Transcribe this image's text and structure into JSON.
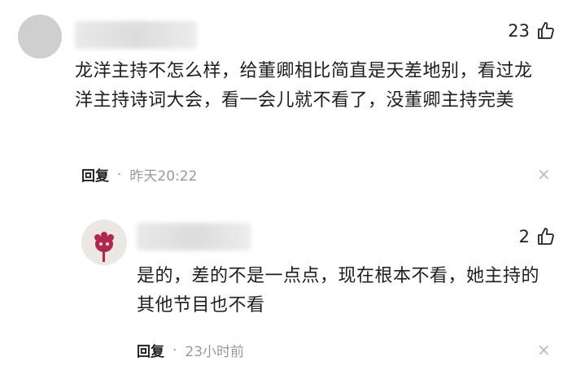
{
  "comments": [
    {
      "likes": "23",
      "text": "龙洋主持不怎么样，给董卿相比简直是天差地别，看过龙洋主持诗词大会，看一会儿就不看了，没董卿主持完美",
      "reply_label": "回复",
      "separator": "·",
      "time": "昨天20:22",
      "close_glyph": "×"
    },
    {
      "likes": "2",
      "text": "是的，差的不是一点点，现在根本不看，她主持的其他节目也不看",
      "reply_label": "回复",
      "separator": "·",
      "time": "23小时前",
      "close_glyph": "×"
    }
  ],
  "icons": {
    "like": "thumbs-up-icon",
    "close": "close-icon"
  },
  "colors": {
    "text": "#1e1e1e",
    "meta": "#9a9a9a",
    "avatar_flower": "#b0284e"
  }
}
